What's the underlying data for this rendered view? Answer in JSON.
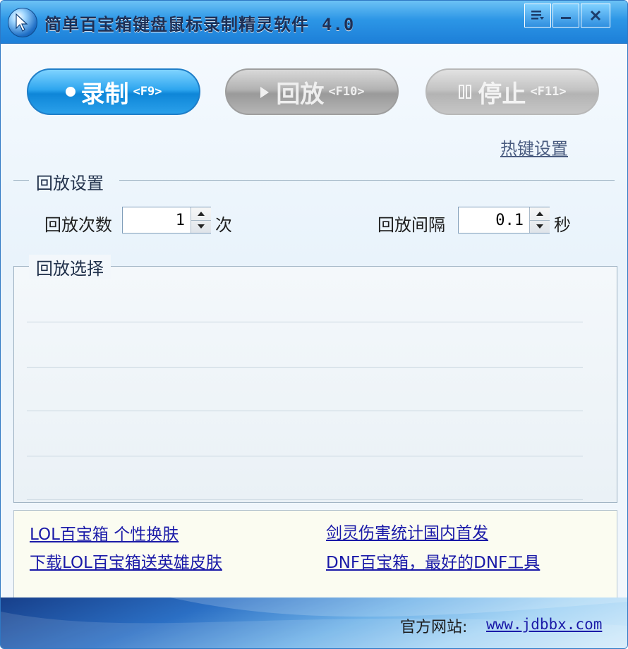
{
  "window": {
    "title": "简单百宝箱键盘鼠标录制精灵软件",
    "version": "4.0",
    "accent_color": "#2c96e6"
  },
  "titlebar_buttons": [
    {
      "icon": "menu-icon"
    },
    {
      "icon": "minimize-icon"
    },
    {
      "icon": "close-icon"
    }
  ],
  "actions": {
    "record": {
      "label": "录制",
      "hotkey": "<F9>",
      "icon": "record-dot-icon",
      "enabled": true
    },
    "play": {
      "label": "回放",
      "hotkey": "<F10>",
      "icon": "play-icon",
      "enabled": false
    },
    "stop": {
      "label": "停止",
      "hotkey": "<F11>",
      "icon": "pause-icon",
      "enabled": false
    }
  },
  "hotkey_settings_link": "热键设置",
  "playback_settings": {
    "group_title": "回放设置",
    "count_label": "回放次数",
    "count_value": "1",
    "count_unit": "次",
    "interval_label": "回放间隔",
    "interval_value": "0.1",
    "interval_unit": "秒"
  },
  "playback_selection": {
    "group_title": "回放选择",
    "rows": [
      "",
      "",
      "",
      "",
      ""
    ]
  },
  "promo_links": [
    "LOL百宝箱 个性换肤",
    "下载LOL百宝箱送英雄皮肤",
    "剑灵伤害统计国内首发",
    "DNF百宝箱，最好的DNF工具"
  ],
  "footer": {
    "site_label": "官方网站:",
    "site_url": "www.jdbbx.com"
  }
}
